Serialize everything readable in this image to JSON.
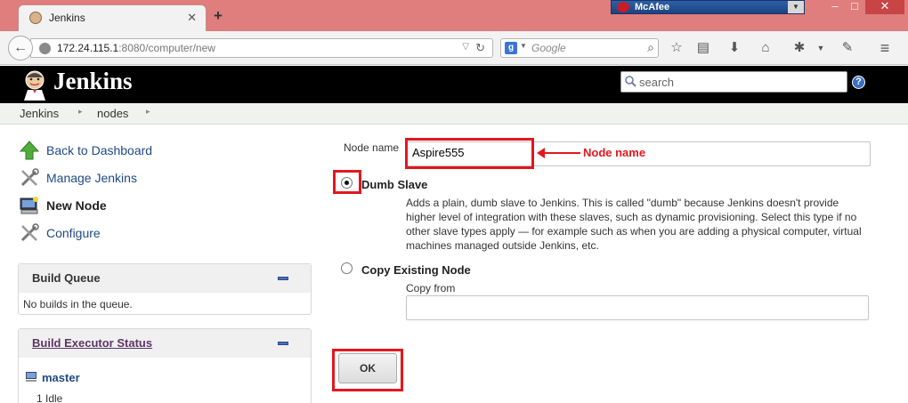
{
  "browser": {
    "tab_title": "Jenkins",
    "new_tab": "+",
    "url_host": "172.24.115.1",
    "url_rest": ":8080/computer/new",
    "search_placeholder": "Google",
    "addon_label": "McAfee"
  },
  "header": {
    "title": "Jenkins",
    "search_placeholder": "search",
    "help": "?"
  },
  "breadcrumb": [
    "Jenkins",
    "nodes"
  ],
  "sidebar": {
    "tasks": [
      {
        "label": "Back to Dashboard",
        "icon": "up-arrow-icon"
      },
      {
        "label": "Manage Jenkins",
        "icon": "wrench-screwdriver-icon"
      },
      {
        "label": "New Node",
        "icon": "computer-icon"
      },
      {
        "label": "Configure",
        "icon": "wrench-screwdriver-icon"
      }
    ],
    "build_queue": {
      "title": "Build Queue",
      "empty_text": "No builds in the queue."
    },
    "executor_status": {
      "title": "Build Executor Status",
      "master": "master",
      "executor": "1  Idle"
    }
  },
  "form": {
    "node_name_label": "Node name",
    "node_name_value": "Aspire555",
    "dumb_slave_label": "Dumb Slave",
    "dumb_slave_desc": "Adds a plain, dumb slave to Jenkins. This is called \"dumb\" because Jenkins doesn't provide higher level of integration with these slaves, such as dynamic provisioning. Select this type if no other slave types apply — for example such as when you are adding a physical computer, virtual machines managed outside Jenkins, etc.",
    "copy_label": "Copy Existing Node",
    "copy_from_label": "Copy from",
    "copy_from_value": "",
    "ok_label": "OK",
    "selected_option": "Dumb Slave"
  },
  "annotation": {
    "text": "Node name",
    "color": "#e3171d"
  },
  "colors": {
    "titlebar": "#e07d7d",
    "header": "#000000",
    "link": "#204a87",
    "annotation": "#e3171d"
  }
}
